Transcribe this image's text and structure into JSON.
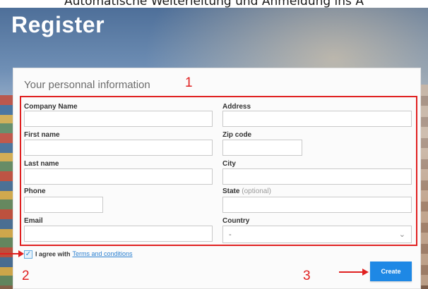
{
  "caption": "Automatische Weiterleitung und Anmeldung ins A",
  "page": {
    "title": "Register",
    "section_title": "Your personnal information"
  },
  "annotations": {
    "step1": "1",
    "step2": "2",
    "step3": "3",
    "color": "#e02020"
  },
  "form": {
    "company_name": {
      "label": "Company Name",
      "value": ""
    },
    "address": {
      "label": "Address",
      "value": ""
    },
    "first_name": {
      "label": "First name",
      "value": ""
    },
    "zip_code": {
      "label": "Zip code",
      "value": ""
    },
    "last_name": {
      "label": "Last name",
      "value": ""
    },
    "city": {
      "label": "City",
      "value": ""
    },
    "phone": {
      "label": "Phone",
      "value": ""
    },
    "state": {
      "label": "State",
      "optional": "(optional)",
      "value": ""
    },
    "email": {
      "label": "Email",
      "value": ""
    },
    "country": {
      "label": "Country",
      "selected": "-"
    }
  },
  "agree": {
    "checked": true,
    "text": "I agree with",
    "link": "Terms and conditions"
  },
  "actions": {
    "create_label": "Create",
    "accent": "#1e88e5"
  }
}
